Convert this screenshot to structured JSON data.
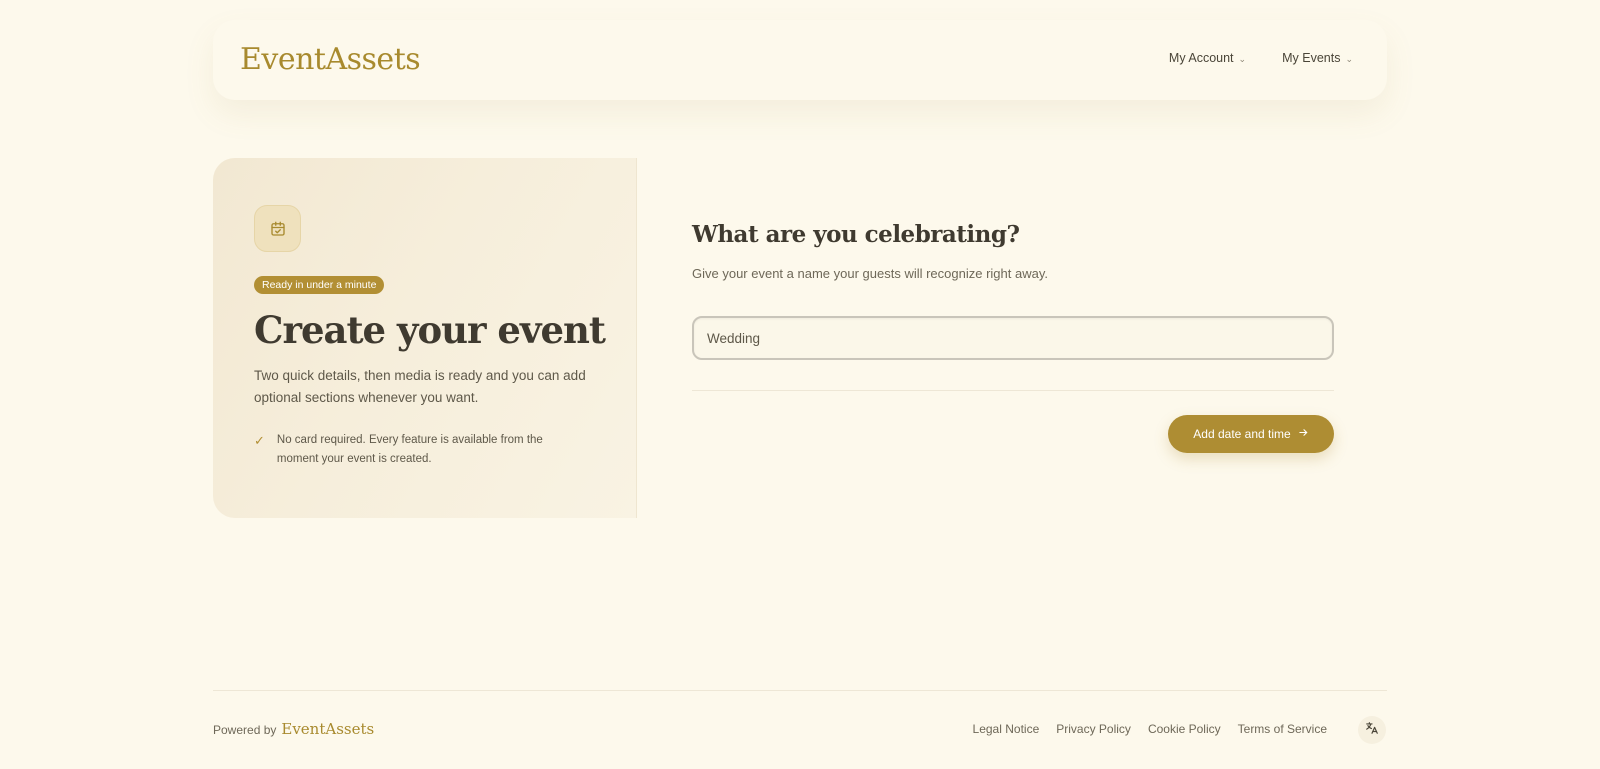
{
  "header": {
    "logo": "EventAssets",
    "nav": [
      {
        "label": "My Account"
      },
      {
        "label": "My Events"
      }
    ]
  },
  "hero": {
    "badge": "Ready in under a minute",
    "title": "Create your event",
    "description": "Two quick details, then media is ready and you can add optional sections whenever you want.",
    "feature": "No card required. Every feature is available from the moment your event is created."
  },
  "form": {
    "question": "What are you celebrating?",
    "subtitle": "Give your event a name your guests will recognize right away.",
    "event_name_value": "Wedding",
    "next_button": "Add date and time"
  },
  "footer": {
    "powered_by": "Powered by",
    "logo": "EventAssets",
    "links": [
      "Legal Notice",
      "Privacy Policy",
      "Cookie Policy",
      "Terms of Service"
    ]
  },
  "icons": {
    "calendar": "calendar-check-icon",
    "check": "check-icon",
    "arrow": "arrow-right-icon",
    "language": "translate-icon",
    "chevron": "chevron-down-icon"
  },
  "colors": {
    "accent": "#ae8d33",
    "background": "#fdf9ec",
    "panel": "#f4ebd6"
  }
}
